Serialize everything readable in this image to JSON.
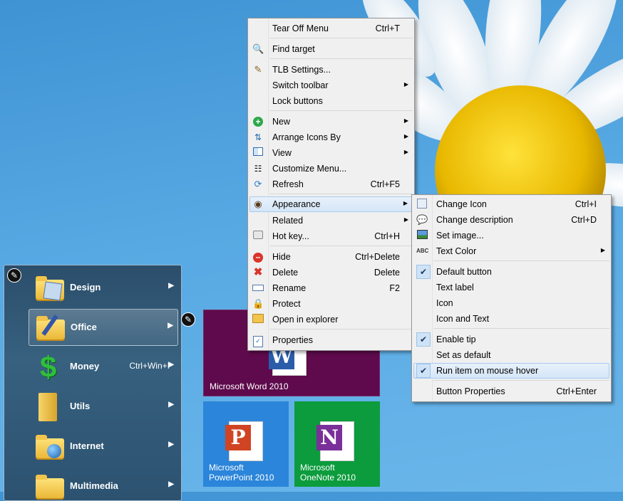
{
  "launcher": {
    "items": [
      {
        "label": "Design",
        "shortcut": "",
        "icon": "design-folder-icon"
      },
      {
        "label": "Office",
        "shortcut": "",
        "icon": "office-folder-icon"
      },
      {
        "label": "Money",
        "shortcut": "Ctrl+Win+I",
        "icon": "dollar-icon"
      },
      {
        "label": "Utils",
        "shortcut": "",
        "icon": "folder-icon"
      },
      {
        "label": "Internet",
        "shortcut": "",
        "icon": "internet-folder-icon"
      },
      {
        "label": "Multimedia",
        "shortcut": "",
        "icon": "multimedia-folder-icon"
      }
    ]
  },
  "tiles": {
    "word": {
      "label": "Microsoft Word 2010",
      "badge": "W",
      "color": "#5e0a4c"
    },
    "powerpoint": {
      "label_line1": "Microsoft",
      "label_line2": "PowerPoint 2010",
      "badge": "P",
      "color": "#2b85da"
    },
    "onenote": {
      "label_line1": "Microsoft",
      "label_line2": "OneNote 2010",
      "badge": "N",
      "color": "#0c9c3d"
    }
  },
  "context_menu": {
    "tear_off": {
      "label": "Tear Off Menu",
      "shortcut": "Ctrl+T"
    },
    "find_target": {
      "label": "Find target"
    },
    "tlb_settings": {
      "label": "TLB Settings..."
    },
    "switch_toolbar": {
      "label": "Switch toolbar"
    },
    "lock_buttons": {
      "label": "Lock buttons"
    },
    "new": {
      "label": "New"
    },
    "arrange": {
      "label": "Arrange Icons By"
    },
    "view": {
      "label": "View"
    },
    "customize": {
      "label": "Customize Menu..."
    },
    "refresh": {
      "label": "Refresh",
      "shortcut": "Ctrl+F5"
    },
    "appearance": {
      "label": "Appearance"
    },
    "related": {
      "label": "Related"
    },
    "hot_key": {
      "label": "Hot key...",
      "shortcut": "Ctrl+H"
    },
    "hide": {
      "label": "Hide",
      "shortcut": "Ctrl+Delete"
    },
    "delete": {
      "label": "Delete",
      "shortcut": "Delete"
    },
    "rename": {
      "label": "Rename",
      "shortcut": "F2"
    },
    "protect": {
      "label": "Protect"
    },
    "open_explorer": {
      "label": "Open in explorer"
    },
    "properties": {
      "label": "Properties"
    }
  },
  "appearance_menu": {
    "change_icon": {
      "label": "Change Icon",
      "shortcut": "Ctrl+I"
    },
    "change_desc": {
      "label": "Change description",
      "shortcut": "Ctrl+D"
    },
    "set_image": {
      "label": "Set image..."
    },
    "text_color": {
      "label": "Text Color"
    },
    "default_button": {
      "label": "Default button",
      "checked": true
    },
    "text_label": {
      "label": "Text label",
      "checked": false
    },
    "icon": {
      "label": "Icon",
      "checked": false
    },
    "icon_and_text": {
      "label": "Icon and Text",
      "checked": false
    },
    "enable_tip": {
      "label": "Enable tip",
      "checked": true
    },
    "set_default": {
      "label": "Set as default",
      "checked": false
    },
    "run_on_hover": {
      "label": "Run item on mouse hover",
      "checked": true
    },
    "button_props": {
      "label": "Button Properties",
      "shortcut": "Ctrl+Enter"
    }
  },
  "icons": {
    "check": "✔",
    "submenu_arrow": "▶",
    "wrench": "🔧"
  }
}
